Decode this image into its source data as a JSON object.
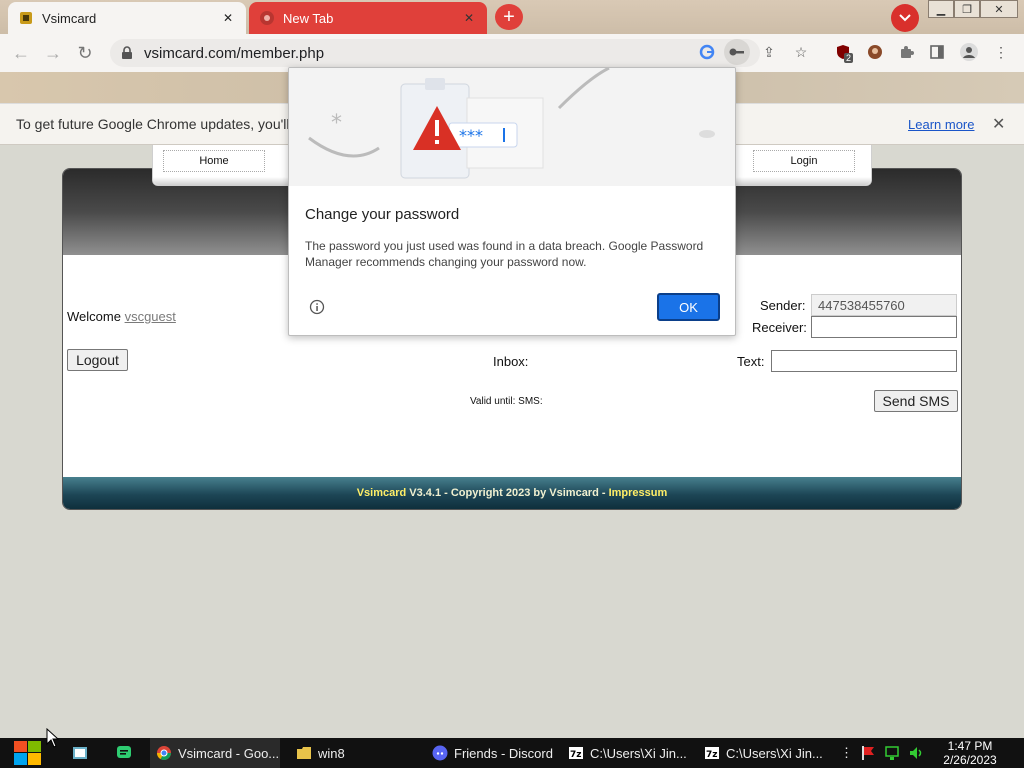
{
  "browser": {
    "tabs": [
      {
        "title": "Vsimcard",
        "active": true
      },
      {
        "title": "New Tab",
        "active": false
      }
    ],
    "url": "vsimcard.com/member.php",
    "extension_badge": "2"
  },
  "infobar": {
    "message": "To get future Google Chrome updates, you'll n",
    "learn_more": "Learn more"
  },
  "site": {
    "menu": [
      "Home",
      "Login"
    ],
    "welcome_label": "Welcome",
    "username": "vscguest",
    "logout_label": "Logout",
    "inbox_label": "Inbox:",
    "sender_label": "Sender:",
    "sender_value": "447538455760",
    "receiver_label": "Receiver:",
    "receiver_value": "",
    "text_label": "Text:",
    "text_value": "",
    "valid_label": "Valid until: SMS:",
    "send_label": "Send SMS",
    "footer": {
      "brand": "Vsimcard",
      "copyright": " V3.4.1 - Copyright 2023 by Vsimcard - ",
      "impressum": "Impressum"
    }
  },
  "dialog": {
    "title": "Change your password",
    "body": "The password you just used was found in a data breach. Google Password Manager recommends changing your password now.",
    "masked_password": "***",
    "ok_label": "OK"
  },
  "taskbar": {
    "items": [
      {
        "label": "Vsimcard - Goo..."
      },
      {
        "label": "win8"
      },
      {
        "label": "Friends - Discord"
      },
      {
        "label": "C:\\Users\\Xi Jin..."
      },
      {
        "label": "C:\\Users\\Xi Jin..."
      }
    ],
    "time": "1:47 PM",
    "date": "2/26/2023"
  },
  "colors": {
    "accent": "#1a73e8",
    "tab_red": "#e0403a",
    "footer_teal": "#1d4656"
  }
}
